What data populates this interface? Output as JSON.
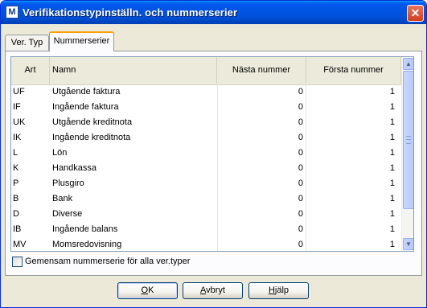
{
  "window": {
    "title": "Verifikationstypinställn. och nummerserier",
    "icon_letter": "M",
    "close_label": "✕"
  },
  "tabs": [
    {
      "label": "Ver. Typ",
      "active": false
    },
    {
      "label": "Nummerserier",
      "active": true
    }
  ],
  "grid": {
    "headers": {
      "art": "Art",
      "namn": "Namn",
      "nasta": "Nästa nummer",
      "forsta": "Första nummer"
    },
    "rows": [
      {
        "art": "UF",
        "namn": "Utgående faktura",
        "nasta": "0",
        "forsta": "1"
      },
      {
        "art": "IF",
        "namn": "Ingående faktura",
        "nasta": "0",
        "forsta": "1"
      },
      {
        "art": "UK",
        "namn": "Utgående kreditnota",
        "nasta": "0",
        "forsta": "1"
      },
      {
        "art": "IK",
        "namn": "Ingående kreditnota",
        "nasta": "0",
        "forsta": "1"
      },
      {
        "art": "L",
        "namn": "Lön",
        "nasta": "0",
        "forsta": "1"
      },
      {
        "art": "K",
        "namn": "Handkassa",
        "nasta": "0",
        "forsta": "1"
      },
      {
        "art": "P",
        "namn": "Plusgiro",
        "nasta": "0",
        "forsta": "1"
      },
      {
        "art": "B",
        "namn": "Bank",
        "nasta": "0",
        "forsta": "1"
      },
      {
        "art": "D",
        "namn": "Diverse",
        "nasta": "0",
        "forsta": "1"
      },
      {
        "art": "IB",
        "namn": "Ingående balans",
        "nasta": "0",
        "forsta": "1"
      },
      {
        "art": "MV",
        "namn": "Momsredovisning",
        "nasta": "0",
        "forsta": "1"
      }
    ]
  },
  "checkbox": {
    "label": "Gemensam nummerserie för alla ver.typer",
    "checked": false
  },
  "buttons": {
    "ok_u": "O",
    "ok_rest": "K",
    "cancel_u": "A",
    "cancel_rest": "vbryt",
    "help_u": "H",
    "help_rest": "jälp"
  }
}
